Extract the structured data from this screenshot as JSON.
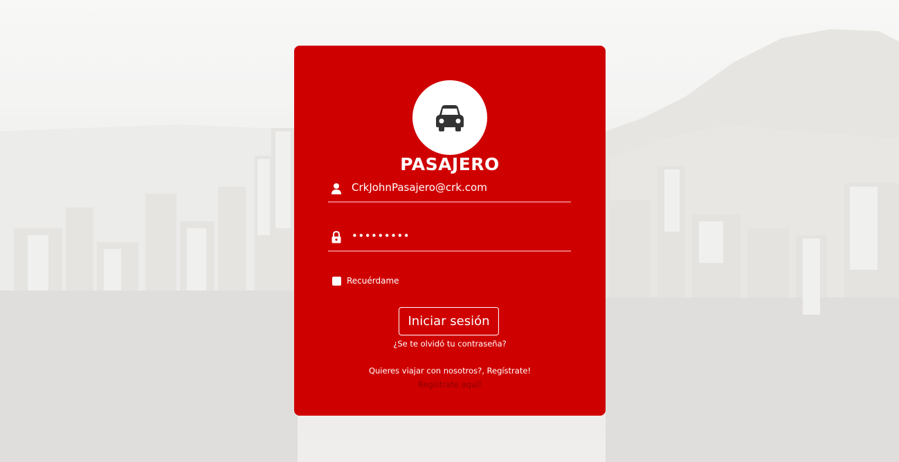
{
  "login": {
    "title": "PASAJERO",
    "avatar_icon": "car-icon",
    "email": {
      "icon": "user-icon",
      "value": "CrkJohnPasajero@crk.com"
    },
    "password": {
      "icon": "lock-icon",
      "value": "•••••••••"
    },
    "remember_label": "Recuérdame",
    "submit_label": "Iniciar sesión",
    "forgot_link": "¿Se te olvidó tu contraseña?",
    "register_text": "Quieres viajar con nosotros?, Regístrate!",
    "register_link": "Regístrate aquí!"
  },
  "colors": {
    "card_background": "#cf0000",
    "text": "#ffffff",
    "register_link": "#8a0000",
    "icon": "#333333"
  }
}
